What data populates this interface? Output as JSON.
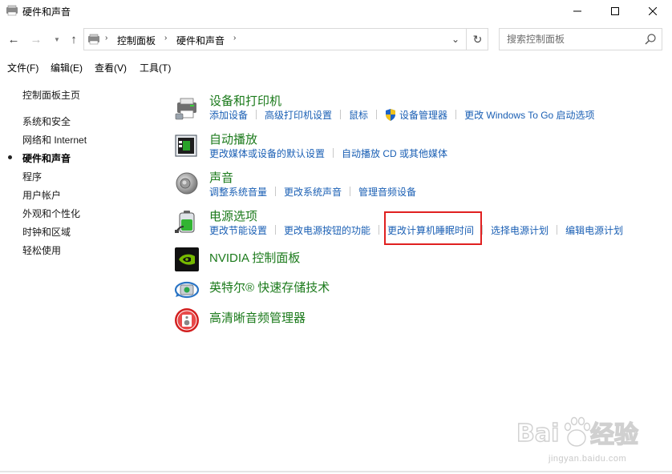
{
  "window": {
    "title": "硬件和声音",
    "controls": {
      "minimize": "—",
      "maximize": "☐",
      "close": "✕"
    }
  },
  "navigation": {
    "back_icon": "←",
    "forward_icon": "→",
    "recent_icon": "▼",
    "up_icon": "↑",
    "breadcrumb": [
      "控制面板",
      "硬件和声音"
    ],
    "breadcrumb_separator": "›",
    "dropdown_icon": "⌄",
    "refresh_icon": "↻"
  },
  "search": {
    "placeholder": "搜索控制面板"
  },
  "menubar": [
    "文件(F)",
    "编辑(E)",
    "查看(V)",
    "工具(T)"
  ],
  "sidebar": {
    "items": [
      {
        "label": "控制面板主页"
      },
      {
        "label": "系统和安全"
      },
      {
        "label": "网络和 Internet"
      },
      {
        "label": "硬件和声音",
        "current": true
      },
      {
        "label": "程序"
      },
      {
        "label": "用户帐户"
      },
      {
        "label": "外观和个性化"
      },
      {
        "label": "时钟和区域"
      },
      {
        "label": "轻松使用"
      }
    ]
  },
  "categories": [
    {
      "title": "设备和打印机",
      "icon": "printer-icon",
      "links": [
        "添加设备",
        "高级打印机设置",
        "鼠标",
        "设备管理器",
        "更改 Windows To Go 启动选项"
      ]
    },
    {
      "title": "自动播放",
      "icon": "autoplay-icon",
      "links": [
        "更改媒体或设备的默认设置",
        "自动播放 CD 或其他媒体"
      ]
    },
    {
      "title": "声音",
      "icon": "speaker-icon",
      "links": [
        "调整系统音量",
        "更改系统声音",
        "管理音频设备"
      ]
    },
    {
      "title": "电源选项",
      "icon": "battery-icon",
      "links": [
        "更改节能设置",
        "更改电源按钮的功能",
        "更改计算机睡眠时间",
        "选择电源计划",
        "编辑电源计划"
      ]
    },
    {
      "title": "NVIDIA 控制面板",
      "icon": "nvidia-icon",
      "links": []
    },
    {
      "title": "英特尔® 快速存储技术",
      "icon": "intel-rst-icon",
      "links": []
    },
    {
      "title": "高清晰音频管理器",
      "icon": "hd-audio-icon",
      "links": []
    }
  ],
  "highlighted_link": "更改计算机睡眠时间",
  "watermark": {
    "text": "jingyan.baidu.com",
    "logo": "Baidu经验"
  },
  "colors": {
    "category_title": "#1b7a1b",
    "link": "#1a5fb4",
    "highlight_box": "#e02020"
  }
}
